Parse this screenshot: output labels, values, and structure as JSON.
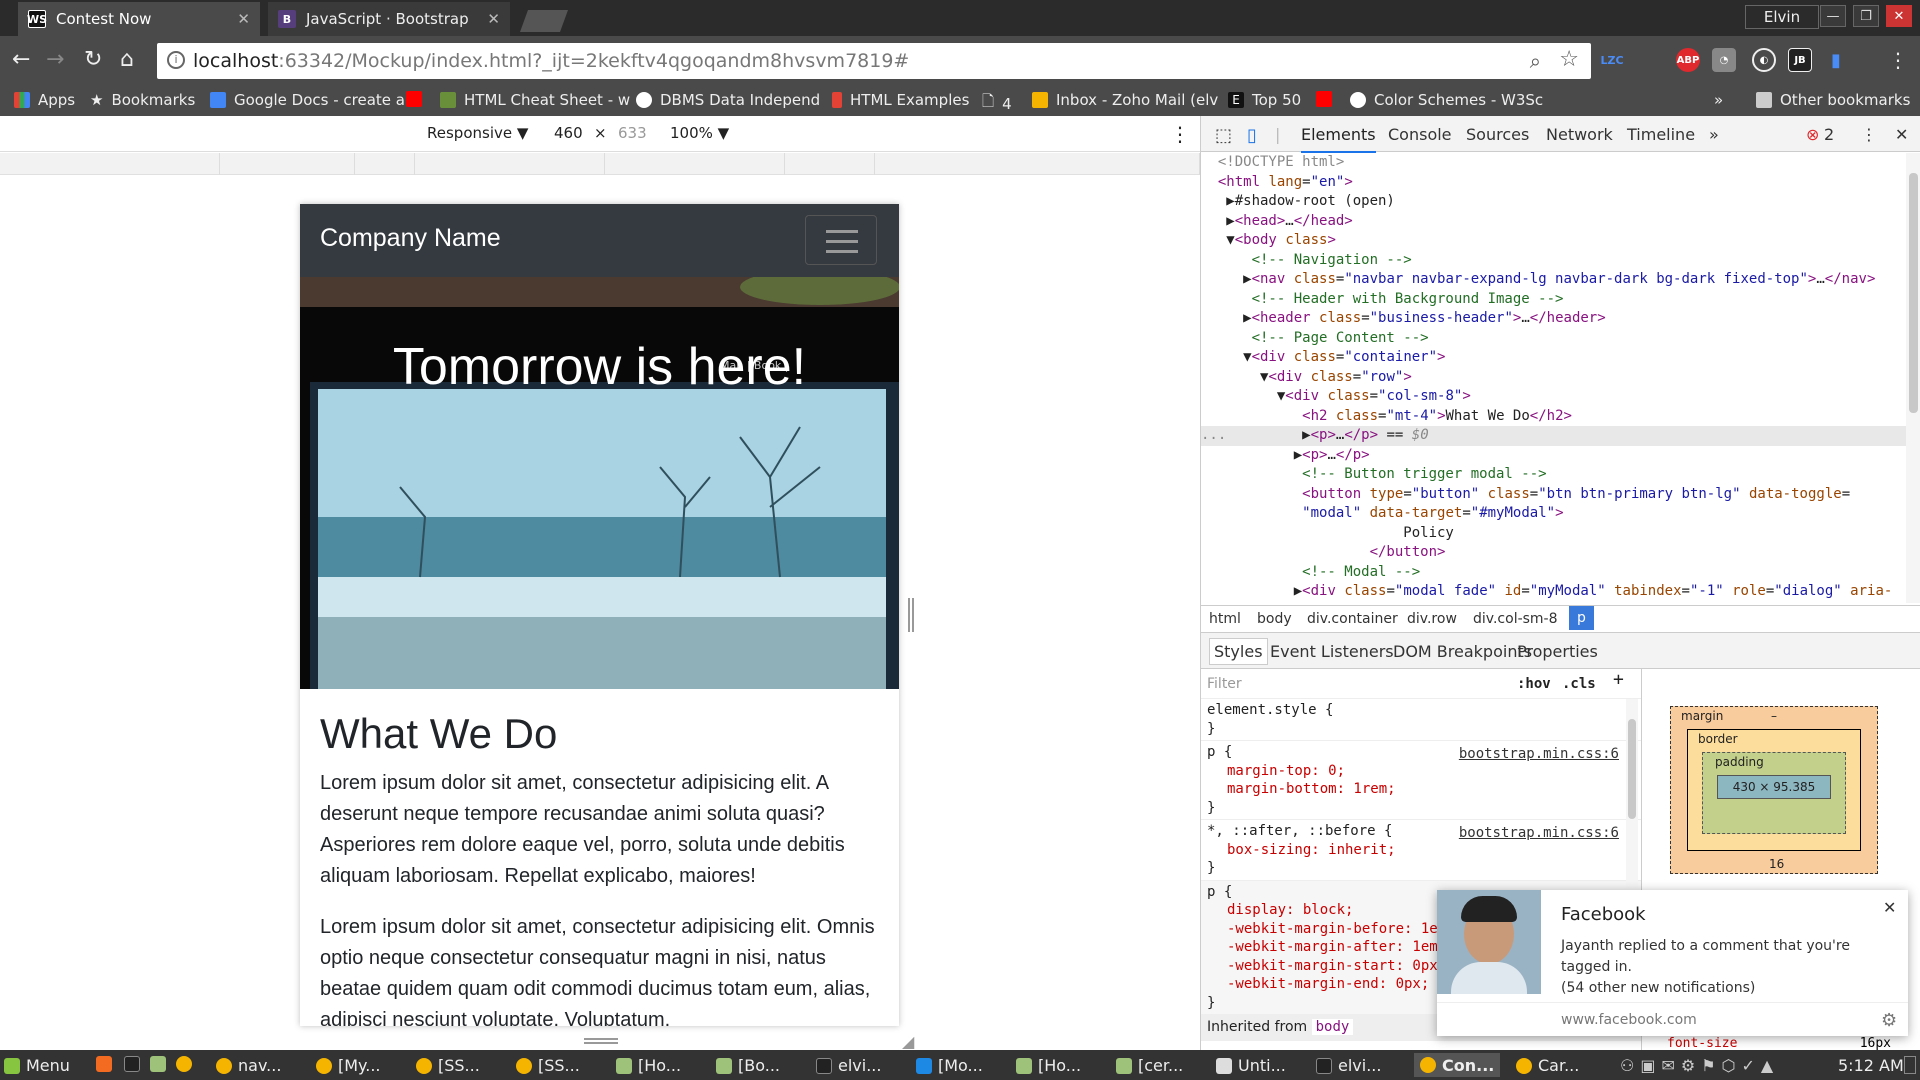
{
  "window": {
    "user": "Elvin",
    "tabs": [
      {
        "label": "Contest Now",
        "favicon": "WS",
        "active": true
      },
      {
        "label": "JavaScript · Bootstrap",
        "favicon": "B",
        "active": false
      }
    ]
  },
  "address": {
    "host": "localhost",
    "rest": ":63342/Mockup/index.html?_ijt=2kekftv4qgoqandm8hvsvm7819#"
  },
  "bookmarks": [
    {
      "label": "Apps",
      "color": "#e34234"
    },
    {
      "label": "Bookmarks",
      "color": "#dddddd"
    },
    {
      "label": "Google Docs - create a",
      "color": "#4285f4"
    },
    {
      "label": "",
      "color": "#ff0000"
    },
    {
      "label": "HTML Cheat Sheet - w",
      "color": "#6a8f3a"
    },
    {
      "label": "DBMS Data Independ",
      "color": "#ffffff"
    },
    {
      "label": "HTML Examples",
      "color": "#e34234"
    },
    {
      "label": "4",
      "color": "#cccccc"
    },
    {
      "label": "Inbox - Zoho Mail (elv",
      "color": "#f4b400"
    },
    {
      "label": "Top 50",
      "color": "#111111"
    },
    {
      "label": "",
      "color": "#ff0000"
    },
    {
      "label": "Color Schemes - W3Sc",
      "color": "#ffffff"
    }
  ],
  "bookmarks_more": "»",
  "other_bookmarks": "Other bookmarks",
  "device_toolbar": {
    "mode": "Responsive ▼",
    "width": "460",
    "times": "×",
    "height": "633",
    "zoom": "100% ▼"
  },
  "emulated_page": {
    "brand": "Company Name",
    "hero_title": "Tomorrow is here!",
    "heading": "What We Do",
    "para1": "Lorem ipsum dolor sit amet, consectetur adipisicing elit. A deserunt neque tempore recusandae animi soluta quasi? Asperiores rem dolore eaque vel, porro, soluta unde debitis aliquam laboriosam. Repellat explicabo, maiores!",
    "para2": "Lorem ipsum dolor sit amet, consectetur adipisicing elit. Omnis optio neque consectetur consequatur magni in nisi, natus beatae quidem quam odit commodi ducimus totam eum, alias, adipisci nesciunt voluptate. Voluptatum."
  },
  "devtools": {
    "tabs": [
      "Elements",
      "Console",
      "Sources",
      "Network",
      "Timeline"
    ],
    "more": "»",
    "error_count": "2",
    "breadcrumbs": [
      "html",
      "body",
      "div.container",
      "div.row",
      "div.col-sm-8",
      "p"
    ],
    "styles_tabs": [
      "Styles",
      "Event Listeners",
      "DOM Breakpoints",
      "Properties"
    ],
    "filter_placeholder": "Filter",
    "hov": ":hov",
    "cls": ".cls",
    "element_style": "element.style {",
    "rule1_selector": "p {",
    "rule1_source": "bootstrap.min.css:6",
    "rule1_props": [
      "margin-top: 0;",
      "margin-bottom: 1rem;"
    ],
    "rule2_selector": "*, ::after, ::before {",
    "rule2_source": "bootstrap.min.css:6",
    "rule2_props": [
      "box-sizing: inherit;"
    ],
    "rule3_selector": "p {",
    "rule3_props": [
      "display: block;",
      "-webkit-margin-before: 1e",
      "-webkit-margin-after: 1em",
      "-webkit-margin-start: 0px",
      "-webkit-margin-end: 0px;"
    ],
    "inherited": "Inherited from",
    "inherited_tag": "body",
    "box_model": {
      "margin_label": "margin",
      "border_label": "border",
      "padding_label": "padding",
      "content": "430 × 95.385",
      "dash": "–",
      "margin_bottom": "16"
    },
    "font_size_prop": "font-size",
    "font_size_val": "16px"
  },
  "notification": {
    "title": "Facebook",
    "body1": "Jayanth replied to a comment that you're",
    "body2": "tagged in.",
    "body3": "(54 other new notifications)",
    "site": "www.facebook.com"
  },
  "taskbar": {
    "menu": "Menu",
    "items": [
      "nav...",
      "[My...",
      "[SS...",
      "[SS...",
      "[Ho...",
      "[Bo...",
      "elvi...",
      "[Mo...",
      "[Ho...",
      "[cer...",
      "Unti...",
      "elvi...",
      "Con...",
      "Car..."
    ],
    "time": "5:12 AM"
  }
}
